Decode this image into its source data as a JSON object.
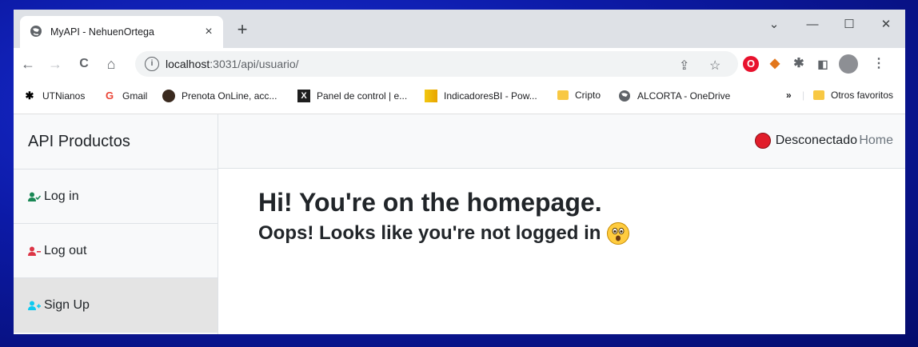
{
  "browser": {
    "tab_title": "MyAPI - NehuenOrtega",
    "tab_close": "×",
    "new_tab": "+",
    "url_host": "localhost",
    "url_path": ":3031/api/usuario/",
    "window_controls": {
      "chevron": "⌄",
      "minimize": "—",
      "maximize": "☐",
      "close": "✕"
    },
    "nav": {
      "back": "←",
      "forward": "→",
      "reload": "C",
      "home": "⌂"
    }
  },
  "bookmarks": [
    {
      "label": "UTNianos",
      "icon": "utn-icon"
    },
    {
      "label": "Gmail",
      "icon": "google-icon"
    },
    {
      "label": "Prenota OnLine, acc...",
      "icon": "prenota-icon"
    },
    {
      "label": "Panel de control | e...",
      "icon": "x-icon"
    },
    {
      "label": "IndicadoresBI - Pow...",
      "icon": "powerbi-icon"
    },
    {
      "label": "Cripto",
      "icon": "folder-icon"
    },
    {
      "label": "ALCORTA - OneDrive",
      "icon": "globe-icon"
    }
  ],
  "bookmarks_more": "»",
  "other_favorites": "Otros favoritos",
  "sidebar": {
    "brand": "API Productos",
    "items": [
      {
        "label": "Log in",
        "icon": "user-check-icon",
        "color": "#198754"
      },
      {
        "label": "Log out",
        "icon": "user-minus-icon",
        "color": "#dc3545"
      },
      {
        "label": "Sign Up",
        "icon": "user-plus-icon",
        "color": "#0dcaf0"
      }
    ]
  },
  "topnav": {
    "status": "Desconectado",
    "status_color": "#e11d2a",
    "home": "Home"
  },
  "main": {
    "heading": "Hi! You're on the homepage.",
    "subheading": "Oops! Looks like you're not logged in",
    "emoji": "astonished-face-icon"
  }
}
